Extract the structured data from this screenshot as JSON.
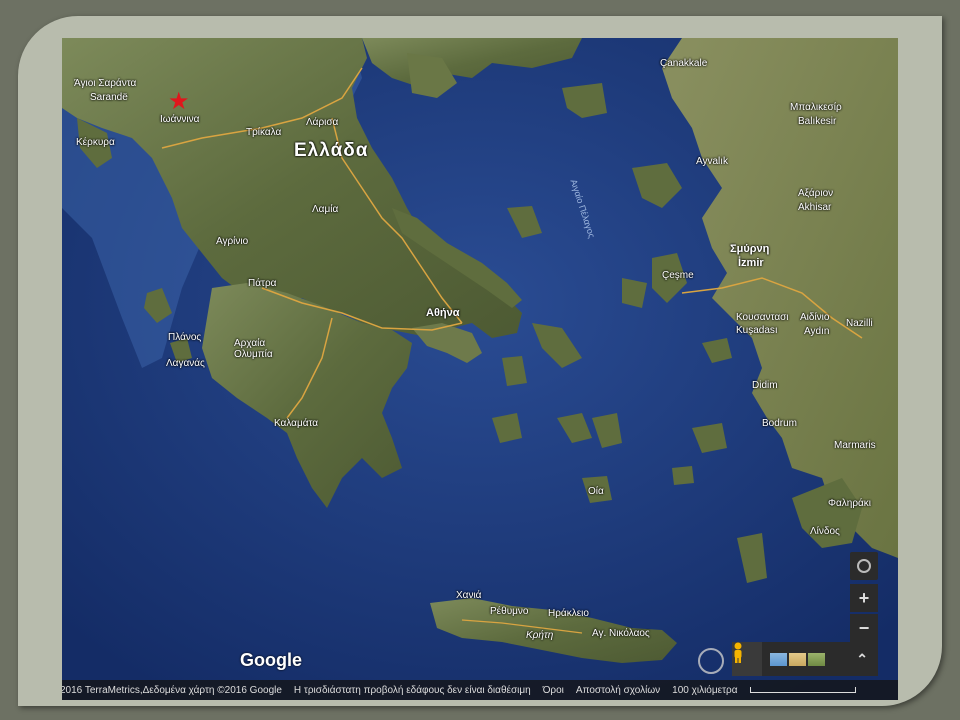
{
  "map": {
    "country_label": "Ελλάδα",
    "sea_label": "Αιγαίο Πέλαγος",
    "places": [
      {
        "id": "agioi-saranta",
        "text": "Άγιοι Σαράντα"
      },
      {
        "id": "sarande",
        "text": "Sarandë"
      },
      {
        "id": "ioannina",
        "text": "Ιωάννινα"
      },
      {
        "id": "kerkyra",
        "text": "Κέρκυρα"
      },
      {
        "id": "trikala",
        "text": "Τρίκαλα"
      },
      {
        "id": "larisa",
        "text": "Λάρισα"
      },
      {
        "id": "lamia",
        "text": "Λαμία"
      },
      {
        "id": "agrinio",
        "text": "Αγρίνιο"
      },
      {
        "id": "patra",
        "text": "Πάτρα"
      },
      {
        "id": "athina",
        "text": "Αθήνα"
      },
      {
        "id": "planos",
        "text": "Πλάνος"
      },
      {
        "id": "laganas",
        "text": "Λαγανάς"
      },
      {
        "id": "archaia-olympia",
        "text": "Αρχαία Ολυμπία"
      },
      {
        "id": "kalamata",
        "text": "Καλαμάτα"
      },
      {
        "id": "canakkale",
        "text": "Çanakkale"
      },
      {
        "id": "balikesir-gr",
        "text": "Μπαλικεσίρ"
      },
      {
        "id": "balikesir",
        "text": "Balıkesir"
      },
      {
        "id": "ayvalik",
        "text": "Ayvalık"
      },
      {
        "id": "akhisar-gr",
        "text": "Αξάριον"
      },
      {
        "id": "akhisar",
        "text": "Akhisar"
      },
      {
        "id": "smyrni",
        "text": "Σμύρνη"
      },
      {
        "id": "izmir",
        "text": "İzmir"
      },
      {
        "id": "cesme",
        "text": "Çeşme"
      },
      {
        "id": "kousantasi",
        "text": "Κουσαντασι"
      },
      {
        "id": "kusadasi",
        "text": "Kuşadası"
      },
      {
        "id": "aidinio",
        "text": "Αιδίνιο"
      },
      {
        "id": "aydin",
        "text": "Aydın"
      },
      {
        "id": "nazilli",
        "text": "Nazilli"
      },
      {
        "id": "didim",
        "text": "Didim"
      },
      {
        "id": "bodrum",
        "text": "Bodrum"
      },
      {
        "id": "marmaris",
        "text": "Marmaris"
      },
      {
        "id": "faliraki",
        "text": "Φαληράκι"
      },
      {
        "id": "lindos",
        "text": "Λίνδος"
      },
      {
        "id": "oia",
        "text": "Οία"
      },
      {
        "id": "chania",
        "text": "Χανιά"
      },
      {
        "id": "rethymno",
        "text": "Ρέθυμνο"
      },
      {
        "id": "irakleio",
        "text": "Ηράκλειο"
      },
      {
        "id": "kriti",
        "text": "Κρήτη"
      },
      {
        "id": "ag-nikolaos",
        "text": "Αγ. Νικόλαος"
      }
    ]
  },
  "brand": "Google",
  "controls": {
    "zoom_in": "+",
    "zoom_out": "−",
    "expand": "⌃"
  },
  "footer": {
    "copyright": "2016 TerraMetrics,Δεδομένα χάρτη ©2016 Google",
    "notice": "Η τρισδιάστατη προβολή εδάφους δεν είναι διαθέσιμη",
    "terms": "Όροι",
    "feedback": "Αποστολή σχολίων",
    "scale": "100 χιλιόμετρα"
  },
  "colors": {
    "sea": "#1f3f82",
    "land": "#5a6b3c",
    "marker": "#e0161c",
    "road": "#d9a441"
  }
}
